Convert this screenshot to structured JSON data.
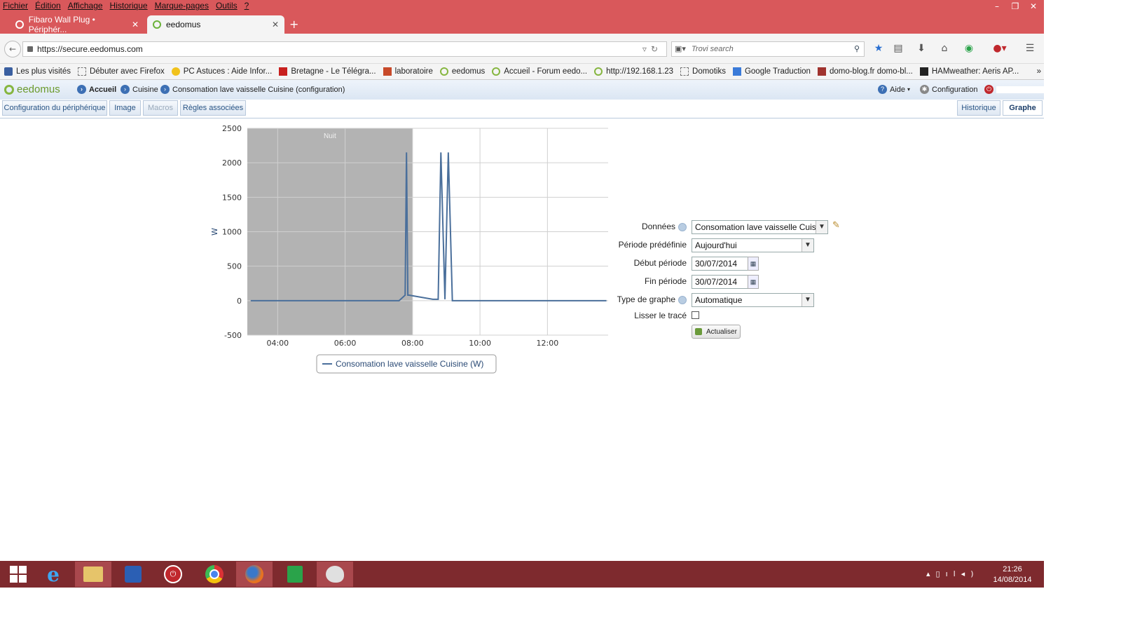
{
  "menu": [
    "Fichier",
    "Édition",
    "Affichage",
    "Historique",
    "Marque-pages",
    "Outils",
    "?"
  ],
  "window_controls": [
    "–",
    "❐",
    "✕"
  ],
  "tabs": [
    {
      "label": "Fibaro Wall Plug • Périphér..."
    },
    {
      "label": "eedomus"
    }
  ],
  "url": "https://secure.eedomus.com",
  "search_placeholder": "Trovi search",
  "bookmarks": [
    "Les plus visités",
    "Débuter avec Firefox",
    "PC Astuces : Aide Infor...",
    "Bretagne - Le Télégra...",
    "laboratoire",
    "eedomus",
    "Accueil - Forum eedo...",
    "http://192.168.1.23",
    "Domotiks",
    "Google Traduction",
    "domo-blog.fr domo-bl...",
    "HAMweather: Aeris AP..."
  ],
  "app": {
    "logo": "eedomus",
    "breadcrumb": [
      "Accueil",
      "Cuisine",
      "Consomation lave vaisselle Cuisine (configuration)"
    ],
    "help": "Aide",
    "config": "Configuration"
  },
  "subtabs": {
    "left": [
      "Configuration du périphérique",
      "Image",
      "Macros",
      "Règles associées"
    ],
    "right": [
      "Historique",
      "Graphe"
    ]
  },
  "chart_data": {
    "type": "line",
    "title": "",
    "ylabel": "W",
    "ylim": [
      -500,
      2500
    ],
    "yticks": [
      2500,
      2000,
      1500,
      1000,
      500,
      0,
      -500
    ],
    "xticks": [
      "04:00",
      "06:00",
      "08:00",
      "10:00",
      "12:00"
    ],
    "x_range_hours": [
      3.1,
      13.8
    ],
    "night_band": {
      "label": "Nuit",
      "from": 3.1,
      "to": 8.0
    },
    "series": [
      {
        "name": "Consomation lave vaisselle Cuisine (W)",
        "color": "#4a6f9b",
        "x": [
          3.2,
          7.6,
          7.78,
          7.82,
          7.86,
          7.9,
          8.6,
          8.76,
          8.84,
          8.96,
          9.06,
          9.18,
          13.75
        ],
        "y": [
          0,
          0,
          80,
          2150,
          80,
          80,
          20,
          20,
          2150,
          20,
          2150,
          0,
          0
        ]
      }
    ],
    "legend": "Consomation lave vaisselle Cuisine (W)",
    "legend_position": "bottom"
  },
  "form": {
    "donnees_label": "Données",
    "donnees_value": "Consomation lave vaisselle Cuisine",
    "periode_label": "Période prédéfinie",
    "periode_value": "Aujourd'hui",
    "debut_label": "Début période",
    "debut_value": "30/07/2014",
    "fin_label": "Fin période",
    "fin_value": "30/07/2014",
    "type_label": "Type de graphe",
    "type_value": "Automatique",
    "lisser_label": "Lisser le tracé",
    "refresh_label": "Actualiser"
  },
  "taskbar": {
    "time": "21:26",
    "date": "14/08/2014"
  }
}
